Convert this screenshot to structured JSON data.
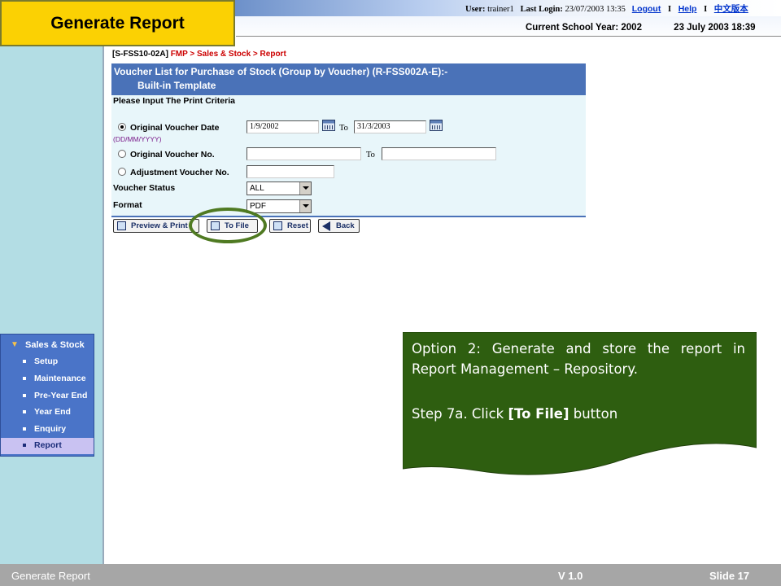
{
  "slide_title": "Generate Report",
  "header": {
    "user_label": "User:",
    "user_value": "trainer1",
    "last_login_label": "Last Login:",
    "last_login_value": "23/07/2003 13:35",
    "logout": "Logout",
    "separator": "I",
    "help": "Help",
    "chinese": "中文版本",
    "school_year": "Current School Year: 2002",
    "datetime": "23 July 2003 18:39"
  },
  "breadcrumb": {
    "code": "[S-FSS10-02A]",
    "path": "FMP > Sales & Stock > Report"
  },
  "form": {
    "title_line1": "Voucher List for Purchase of Stock (Group by Voucher) (R-FSS002A-E):-",
    "title_line2": "Built-in Template",
    "criteria_label": "Please Input The Print Criteria",
    "date_label": "Original Voucher Date",
    "date_format": "(DD/MM/YYYY)",
    "date_from": "1/9/2002",
    "to_label": "To",
    "date_to": "31/3/2003",
    "voucher_no_label": "Original Voucher No.",
    "voucher_no_from": "",
    "voucher_no_to": "",
    "adj_voucher_label": "Adjustment Voucher No.",
    "adj_voucher_value": "",
    "status_label": "Voucher Status",
    "status_value": "ALL",
    "format_label": "Format",
    "format_value": "PDF"
  },
  "buttons": {
    "preview": "Preview & Print",
    "to_file": "To File",
    "reset": "Reset",
    "back": "Back"
  },
  "sidebar": {
    "header": "Sales & Stock",
    "items": [
      {
        "label": "Setup"
      },
      {
        "label": "Maintenance"
      },
      {
        "label": "Pre-Year End"
      },
      {
        "label": "Year End"
      },
      {
        "label": "Enquiry"
      },
      {
        "label": "Report",
        "selected": true
      }
    ]
  },
  "callout": {
    "para1": "Option 2: Generate and store the report in Report Management – Repository.",
    "para2_prefix": "Step 7a. Click ",
    "para2_bold": "[To File]",
    "para2_suffix": " button"
  },
  "footer": {
    "left": "Generate Report",
    "version": "V 1.0",
    "slide": "Slide 17"
  },
  "colors": {
    "title_bg": "#fbd103",
    "sidebar_bg": "#b3dde4",
    "nav_bg": "#4a74c8",
    "form_header_bg": "#4a72b8",
    "callout_bg": "#2e5e10",
    "highlight": "#4f7a22",
    "footer_bg": "#a6a6a6"
  }
}
